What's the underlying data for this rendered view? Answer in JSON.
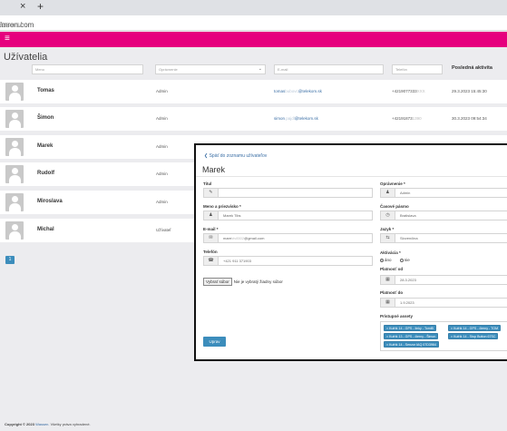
{
  "browser": {
    "close_glyph": "×",
    "new_tab_glyph": "+",
    "url_host": "imron.com",
    "url_path": "/users/"
  },
  "appbar": {
    "menu_glyph": "≡",
    "color": "#e6007e"
  },
  "page": {
    "title": "Užívatelia"
  },
  "filters": {
    "name_placeholder": "Meno",
    "role_placeholder": "Oprávnenie",
    "email_placeholder": "E-mail",
    "phone_placeholder": "Telefón",
    "last_activity_header": "Posledná aktivita"
  },
  "users": [
    {
      "name": "Tomas",
      "role": "Admin",
      "email_pre": "tomas",
      "email_blur": "bubovc",
      "email_post": "@telekom.sk",
      "phone_pre": "+4219077333",
      "phone_blur": "XXX",
      "last_activity": "29.3.2023 15:45:30"
    },
    {
      "name": "Šimon",
      "role": "Admin",
      "email_pre": "simon",
      "email_blur": ".pajdl",
      "email_post": "@telekom.sk",
      "phone_pre": "+42191873",
      "phone_blur": "1390",
      "last_activity": "30.3.2023 09:54:34"
    },
    {
      "name": "Marek",
      "role": "Admin",
      "email_pre": "",
      "email_blur": "",
      "email_post": "",
      "phone_pre": "",
      "phone_blur": "",
      "last_activity": ""
    },
    {
      "name": "Rudolf",
      "role": "Admin",
      "email_pre": "",
      "email_blur": "",
      "email_post": "",
      "phone_pre": "",
      "phone_blur": "",
      "last_activity": ""
    },
    {
      "name": "Miroslava",
      "role": "Admin",
      "email_pre": "",
      "email_blur": "",
      "email_post": "",
      "phone_pre": "",
      "phone_blur": "",
      "last_activity": ""
    },
    {
      "name": "Michal",
      "role": "Užívateľ",
      "email_pre": "",
      "email_blur": "",
      "email_post": "",
      "phone_pre": "",
      "phone_blur": "",
      "last_activity": ""
    }
  ],
  "pagination": {
    "current": "1"
  },
  "footer": {
    "copyright": "Copyright © 2023",
    "brand": "Wassen.",
    "rights": "Všetky práva vyhradené."
  },
  "modal": {
    "back_link": "Späť do zoznamu užívateľov",
    "back_glyph": "❮",
    "title": "Marek",
    "titul_label": "Titul",
    "titul_icon": "✎",
    "name_label": "Meno a priezvisko *",
    "name_icon": "♟",
    "name_value": "Marek Tibs",
    "email_label": "E-mail *",
    "email_icon": "✉",
    "email_value_pre": "mare",
    "email_value_blur": "ktv8502",
    "email_value_post": "@gmail.com",
    "phone_label": "Telefón",
    "phone_icon": "☎",
    "phone_value": "+421 911 371903",
    "file_button": "Vybrať súbor",
    "file_status": "Nie je vybratý žiadny súbor",
    "save_button": "Uprav",
    "role_label": "Oprávnenie *",
    "role_icon": "♟",
    "role_value": "Admin",
    "tz_label": "Časové pásmo",
    "tz_icon": "◷",
    "tz_value": "Bratislava",
    "lang_label": "Jazyk *",
    "lang_icon": "⇆",
    "lang_value": "Slovenčina",
    "active_label": "Aktivácia *",
    "active_yes": "áno",
    "active_no": "nie",
    "from_label": "Platnosť od",
    "from_icon": "▦",
    "from_value": "28.3.2023",
    "to_label": "Platnosť do",
    "to_icon": "▦",
    "to_value": "1.9.2023",
    "assets_label": "Prístupné assety",
    "assets": [
      "× Kufrík 14 - GPS - Iinky - TomiB",
      "× Kufrík 14 - GPS - čierny - TOM",
      "× Kufrík 13 - GPS - čierny - Šimon",
      "× Kufrík 14 - Stop Button 67SC",
      "× Kufrík 14 - Senzor IAQ 07D3964"
    ]
  }
}
